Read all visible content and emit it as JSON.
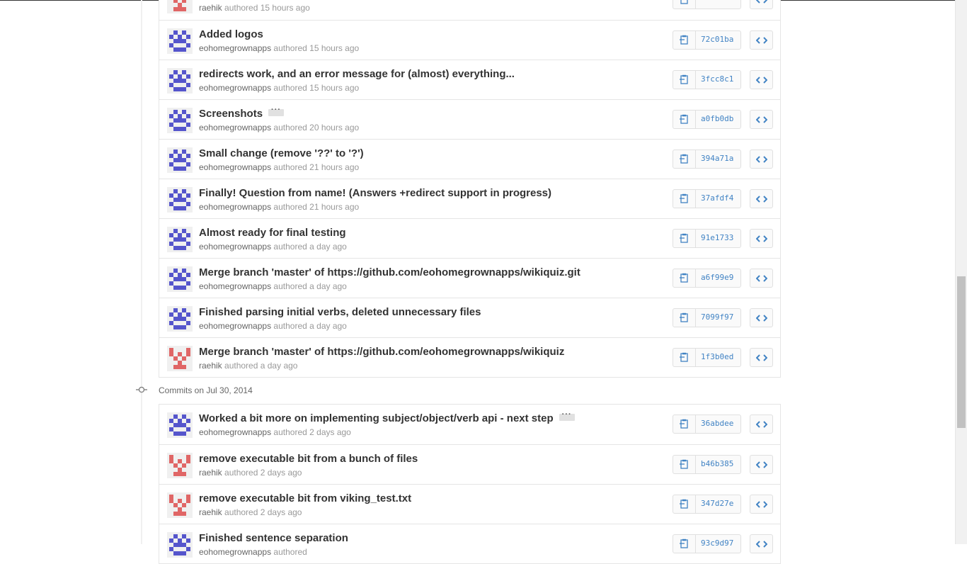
{
  "colors": {
    "identicon_blue": "#5555cc",
    "identicon_red": "#e06666",
    "sha_link": "#4183c4"
  },
  "icons": {
    "copy": "clipboard-icon",
    "browse": "code-icon",
    "group": "commit-icon"
  },
  "authored_word": "authored",
  "group1": {
    "commits": [
      {
        "title": "",
        "author": "raehik",
        "time": "15 hours ago",
        "sha": "",
        "avatar": "red"
      },
      {
        "title": "Added logos",
        "author": "eohomegrownapps",
        "time": "15 hours ago",
        "sha": "72c01ba",
        "avatar": "blue"
      },
      {
        "title": "redirects work, and an error message for (almost) everything...",
        "author": "eohomegrownapps",
        "time": "15 hours ago",
        "sha": "3fcc8c1",
        "avatar": "blue"
      },
      {
        "title": "Screenshots",
        "author": "eohomegrownapps",
        "time": "20 hours ago",
        "sha": "a0fb0db",
        "avatar": "blue",
        "has_more": true
      },
      {
        "title": "Small change (remove '??' to '?')",
        "author": "eohomegrownapps",
        "time": "21 hours ago",
        "sha": "394a71a",
        "avatar": "blue"
      },
      {
        "title": "Finally! Question from name! (Answers +redirect support in progress)",
        "author": "eohomegrownapps",
        "time": "21 hours ago",
        "sha": "37afdf4",
        "avatar": "blue"
      },
      {
        "title": "Almost ready for final testing",
        "author": "eohomegrownapps",
        "time": "a day ago",
        "sha": "91e1733",
        "avatar": "blue"
      },
      {
        "title": "Merge branch 'master' of https://github.com/eohomegrownapps/wikiquiz.git",
        "author": "eohomegrownapps",
        "time": "a day ago",
        "sha": "a6f99e9",
        "avatar": "blue"
      },
      {
        "title": "Finished parsing initial verbs, deleted unnecessary files",
        "author": "eohomegrownapps",
        "time": "a day ago",
        "sha": "7099f97",
        "avatar": "blue"
      },
      {
        "title": "Merge branch 'master' of https://github.com/eohomegrownapps/wikiquiz",
        "author": "raehik",
        "time": "a day ago",
        "sha": "1f3b0ed",
        "avatar": "red"
      }
    ]
  },
  "group2": {
    "header_prefix": "Commits on",
    "header_date": "Jul 30, 2014",
    "commits": [
      {
        "title": "Worked a bit more on implementing subject/object/verb api - next step",
        "author": "eohomegrownapps",
        "time": "2 days ago",
        "sha": "36abdee",
        "avatar": "blue",
        "has_more": true
      },
      {
        "title": "remove executable bit from a bunch of files",
        "author": "raehik",
        "time": "2 days ago",
        "sha": "b46b385",
        "avatar": "red"
      },
      {
        "title": "remove executable bit from viking_test.txt",
        "author": "raehik",
        "time": "2 days ago",
        "sha": "347d27e",
        "avatar": "red"
      },
      {
        "title": "Finished sentence separation",
        "author": "eohomegrownapps",
        "time": "",
        "sha": "93c9d97",
        "avatar": "blue"
      }
    ]
  }
}
